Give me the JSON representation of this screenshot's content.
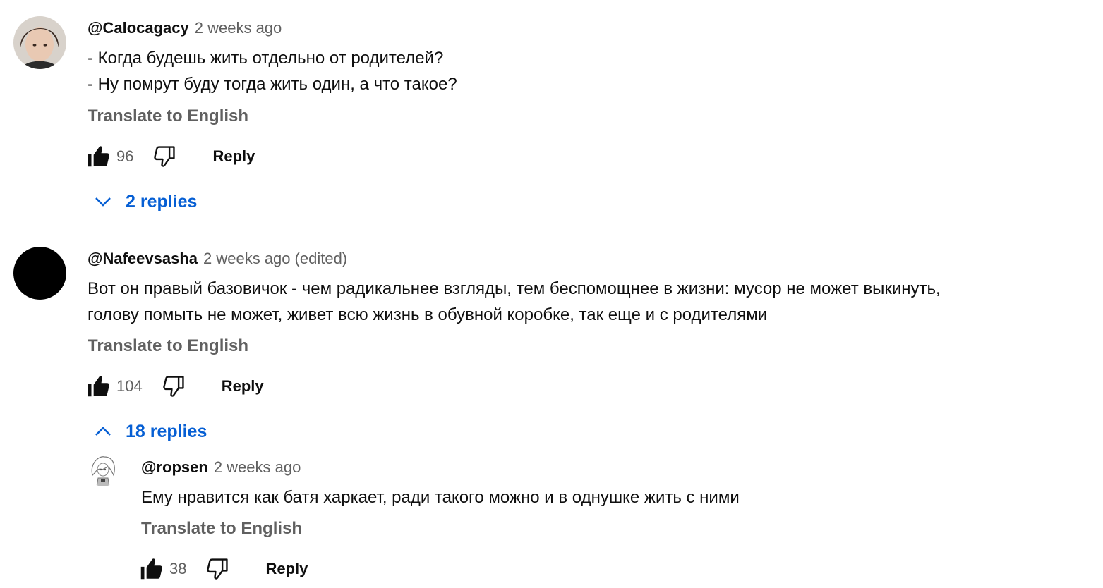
{
  "comments": [
    {
      "author": "@Calocagacy",
      "time": "2 weeks ago",
      "lines": [
        "- Когда будешь жить отдельно от родителей?",
        "- Ну помрут буду тогда жить один, а что такое?"
      ],
      "translate_label": "Translate to English",
      "likes": "96",
      "reply_label": "Reply",
      "replies_label": "2 replies",
      "replies_expanded": false
    },
    {
      "author": "@Nafeevsasha",
      "time": "2 weeks ago",
      "edited": "(edited)",
      "lines": [
        "Вот он правый базовичок - чем радикальнее взгляды, тем беспомощнее в жизни: мусор не может выкинуть,",
        "голову помыть не может, живет всю жизнь в обувной коробке, так еще и с родителями"
      ],
      "translate_label": "Translate to English",
      "likes": "104",
      "reply_label": "Reply",
      "replies_label": "18 replies",
      "replies_expanded": true
    }
  ],
  "reply": {
    "author": "@ropsen",
    "time": "2 weeks ago",
    "lines": [
      "Ему нравится как батя харкает, ради такого можно и в однушке жить с ними"
    ],
    "translate_label": "Translate to English",
    "likes": "38",
    "reply_label": "Reply"
  },
  "colors": {
    "text": "#0f0f0f",
    "secondary": "#606060",
    "link_blue": "#065fd4"
  }
}
